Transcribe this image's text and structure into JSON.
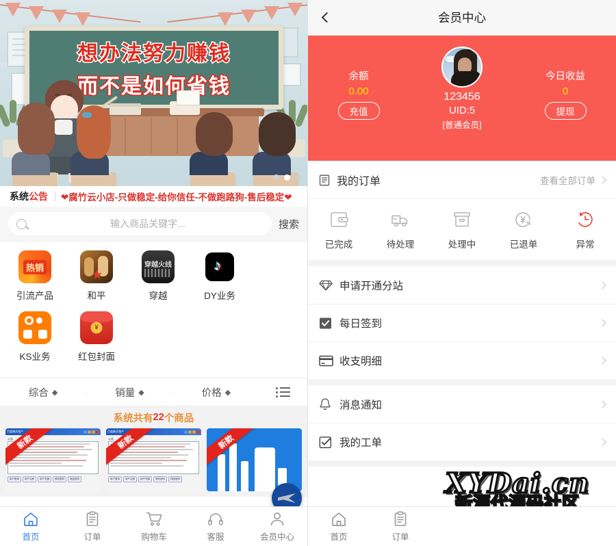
{
  "left": {
    "banner": {
      "line1": "想办法努力赚钱",
      "line2": "而不是如何省钱",
      "alt": "classroom-illustration"
    },
    "announcement": {
      "tag_black": "系统",
      "tag_red": "公告",
      "text": "❤腐竹云小店-只做稳定-给你信任-不做跑路狗-售后稳定❤"
    },
    "search": {
      "placeholder": "输入商品关键字...",
      "button": "搜索",
      "icon": "search-icon"
    },
    "categories": [
      {
        "label": "引流产品",
        "icon": "hot-sale-icon",
        "badge": "热销"
      },
      {
        "label": "和平",
        "icon": "peace-elite-game-icon"
      },
      {
        "label": "穿越",
        "icon": "crossfire-game-icon",
        "text": "穿越火线"
      },
      {
        "label": "DY业务",
        "icon": "douyin-icon"
      },
      {
        "label": "KS业务",
        "icon": "kuaishou-icon"
      },
      {
        "label": "红包封面",
        "icon": "red-packet-icon",
        "symbol": "¥"
      }
    ],
    "sort": [
      {
        "label": "综合",
        "arrow": "◆"
      },
      {
        "label": "销量",
        "arrow": "◆"
      },
      {
        "label": "价格",
        "arrow": "◆"
      }
    ],
    "list_view_icon": "list-view-icon",
    "count": {
      "prefix": "系统共有",
      "number": "22",
      "suffix": "个商品"
    },
    "products": [
      {
        "ribbon": "新款",
        "type": "software-window",
        "title": "百度精灵强产",
        "label": "公告",
        "tabs": [
          "用户登录",
          "用户注册",
          "用户充值",
          "修改密码",
          "找回密码"
        ]
      },
      {
        "ribbon": "新款",
        "type": "software-window",
        "title": "百度精灵强产",
        "label": "公告",
        "tabs": [
          "用户登录",
          "用户注册",
          "用户充值",
          "修改密码",
          "找回密码"
        ]
      },
      {
        "ribbon": "新款",
        "type": "blue-app"
      }
    ],
    "fab": {
      "icon": "paper-plane-icon"
    },
    "tabbar": [
      {
        "label": "首页",
        "icon": "home-icon",
        "active": true
      },
      {
        "label": "订单",
        "icon": "order-icon",
        "active": false
      },
      {
        "label": "购物车",
        "icon": "cart-icon",
        "active": false
      },
      {
        "label": "客服",
        "icon": "headset-icon",
        "active": false
      },
      {
        "label": "会员中心",
        "icon": "user-icon",
        "active": false
      }
    ]
  },
  "right": {
    "navbar": {
      "title": "会员中心",
      "back_icon": "back-chevron-icon"
    },
    "profile": {
      "balance_label": "余额",
      "balance_value": "0.00",
      "recharge_button": "充值",
      "username": "123456",
      "uid": "UID:5",
      "level": "[普通会员]",
      "income_label": "今日收益",
      "income_value": "0",
      "withdraw_button": "提现",
      "avatar_icon": "user-avatar"
    },
    "orders": {
      "title": "我的订单",
      "title_icon": "order-list-icon",
      "view_all": "查看全部订单",
      "items": [
        {
          "label": "已完成",
          "icon": "wallet-icon"
        },
        {
          "label": "待处理",
          "icon": "truck-icon"
        },
        {
          "label": "处理中",
          "icon": "box-icon"
        },
        {
          "label": "已退单",
          "icon": "refund-yen-icon"
        },
        {
          "label": "异常",
          "icon": "clock-alert-icon"
        }
      ]
    },
    "menu_group_1": [
      {
        "label": "申请开通分站",
        "icon": "diamond-icon"
      },
      {
        "label": "每日签到",
        "icon": "checkbox-checked-icon"
      },
      {
        "label": "收支明细",
        "icon": "card-icon"
      }
    ],
    "menu_group_2": [
      {
        "label": "消息通知",
        "icon": "bell-icon"
      },
      {
        "label": "我的工单",
        "icon": "ticket-check-icon"
      }
    ],
    "tabbar": [
      {
        "label": "首页",
        "icon": "home-icon"
      },
      {
        "label": "订单",
        "icon": "order-icon"
      }
    ],
    "watermark": {
      "line1": "XYDai.cn",
      "line2": "新源代源码社区"
    }
  },
  "colors": {
    "brand_red": "#f95a52",
    "accent_yellow": "#ffe400",
    "announce_red": "#d8342b",
    "count_orange": "#e8913a",
    "active_blue": "#3b86e0"
  }
}
